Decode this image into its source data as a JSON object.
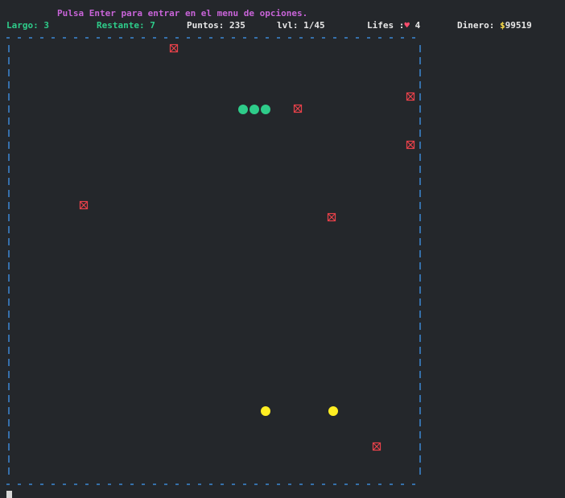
{
  "header": {
    "hint": "Pulsa Enter para entrar en el menu de opciones.",
    "largo_label": "Largo:",
    "largo_value": "3",
    "restante_label": "Restante:",
    "restante_value": "7",
    "puntos_label": "Puntos:",
    "puntos_value": "235",
    "lvl_label": "lvl:",
    "lvl_value": "1/45",
    "lifes_label": "Lifes :",
    "heart": "♥",
    "lifes_value": "4",
    "dinero_label": "Dinero:",
    "currency": "$",
    "dinero_value": "99519"
  },
  "board": {
    "border_color": "#3f8fe0",
    "snake_color": "#2ecc8a",
    "food_color": "#ffee22",
    "obstacle_color": "#e8414a",
    "obstacle_glyph": "⊠"
  },
  "colors": {
    "background": "#24272b",
    "hint": "#c864d8",
    "stat_green": "#2ecc8a",
    "stat_white": "#e8e8e8"
  }
}
